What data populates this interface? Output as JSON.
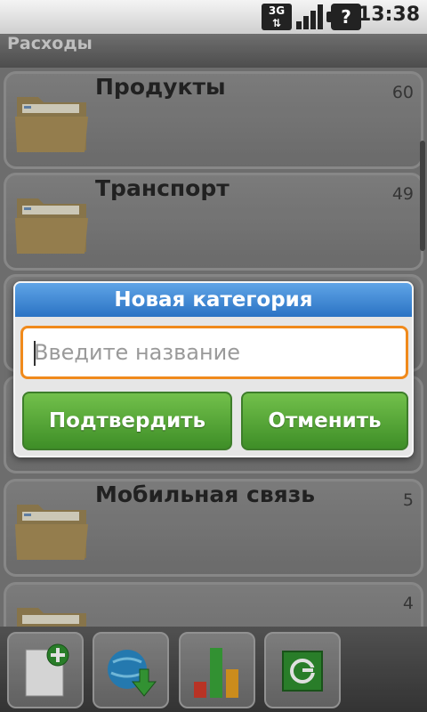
{
  "status_bar": {
    "network": "3G",
    "battery_symbol": "?",
    "time": "13:38"
  },
  "app": {
    "title": "Расходы"
  },
  "categories": [
    {
      "label": "Продукты",
      "count": "60"
    },
    {
      "label": "Транспорт",
      "count": "49"
    },
    {
      "label": "",
      "count": ""
    },
    {
      "label": "",
      "count": ""
    },
    {
      "label": "Мобильная связь",
      "count": "5"
    },
    {
      "label": "",
      "count": "4"
    }
  ],
  "dialog": {
    "title": "Новая категория",
    "input_value": "",
    "input_placeholder": "Введите название",
    "confirm_label": "Подтвердить",
    "cancel_label": "Отменить"
  },
  "toolbar": {
    "buttons": [
      {
        "icon": "add-document-icon"
      },
      {
        "icon": "globe-download-icon"
      },
      {
        "icon": "bar-chart-icon"
      },
      {
        "icon": "refresh-icon"
      }
    ]
  },
  "colors": {
    "dialog_title_bg": "#2b73c4",
    "input_focus_border": "#f08a1c",
    "button_green": "#3e8e27"
  }
}
